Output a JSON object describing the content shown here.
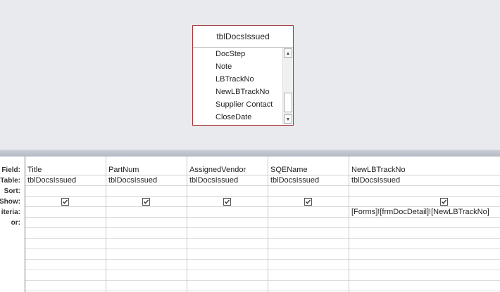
{
  "field_list": {
    "title": "tblDocsIssued",
    "items": [
      "DocStep",
      "Note",
      "LBTrackNo",
      "NewLBTrackNo",
      "Supplier Contact",
      "CloseDate"
    ]
  },
  "row_labels": [
    "Field:",
    "Table:",
    "Sort:",
    "Show:",
    "iteria:",
    "or:"
  ],
  "columns": [
    {
      "field": "Title",
      "table": "tblDocsIssued",
      "sort": "",
      "show": true,
      "criteria": "",
      "or": ""
    },
    {
      "field": "PartNum",
      "table": "tblDocsIssued",
      "sort": "",
      "show": true,
      "criteria": "",
      "or": ""
    },
    {
      "field": "AssignedVendor",
      "table": "tblDocsIssued",
      "sort": "",
      "show": true,
      "criteria": "",
      "or": ""
    },
    {
      "field": "SQEName",
      "table": "tblDocsIssued",
      "sort": "",
      "show": true,
      "criteria": "",
      "or": ""
    },
    {
      "field": "NewLBTrackNo",
      "table": "tblDocsIssued",
      "sort": "",
      "show": true,
      "criteria": "[Forms]![frmDocDetail]![NewLBTrackNo]",
      "or": ""
    }
  ],
  "icons": {
    "scroll_up": "scroll-up-arrow-icon",
    "scroll_down": "scroll-down-arrow-icon",
    "checkmark": "checkmark-icon"
  }
}
